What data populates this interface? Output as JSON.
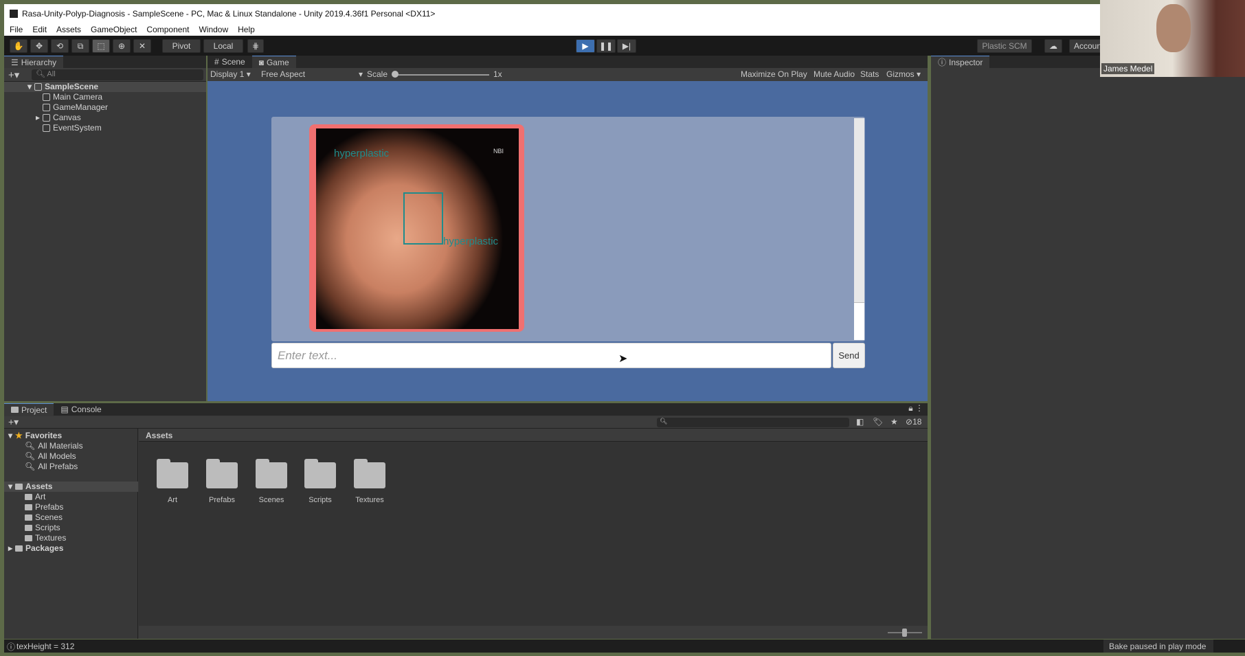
{
  "window": {
    "title": "Rasa-Unity-Polyp-Diagnosis - SampleScene - PC, Mac & Linux Standalone - Unity 2019.4.36f1 Personal <DX11>"
  },
  "menu": [
    "File",
    "Edit",
    "Assets",
    "GameObject",
    "Component",
    "Window",
    "Help"
  ],
  "toolbar": {
    "pivot": "Pivot",
    "local": "Local",
    "plastic": "Plastic SCM",
    "account": "Accoun",
    "play_state": "playing"
  },
  "hierarchy": {
    "tab": "Hierarchy",
    "search_placeholder": "All",
    "scene": "SampleScene",
    "items": [
      "Main Camera",
      "GameManager",
      "Canvas",
      "EventSystem"
    ]
  },
  "game": {
    "tabs": [
      "Scene",
      "Game"
    ],
    "active_tab": "Game",
    "display": "Display 1",
    "aspect": "Free Aspect",
    "scale_label": "Scale",
    "scale_value": "1x",
    "buttons": [
      "Maximize On Play",
      "Mute Audio",
      "Stats",
      "Gizmos"
    ]
  },
  "chat": {
    "image_labels": [
      "hyperplastic",
      "hyperplastic"
    ],
    "image_corner_text": "NBI",
    "input_placeholder": "Enter text...",
    "send": "Send",
    "accent": "#f07070",
    "label_color": "#1f8c8c"
  },
  "inspector": {
    "tab": "Inspector"
  },
  "webcam": {
    "name": "James Medel"
  },
  "project": {
    "tabs": [
      "Project",
      "Console"
    ],
    "favorites_label": "Favorites",
    "favorites": [
      "All Materials",
      "All Models",
      "All Prefabs"
    ],
    "assets_label": "Assets",
    "asset_folders": [
      "Art",
      "Prefabs",
      "Scenes",
      "Scripts",
      "Textures"
    ],
    "packages_label": "Packages",
    "breadcrumb": "Assets",
    "hidden_count": "18"
  },
  "status": {
    "left": "texHeight = 312",
    "right": "Bake paused in play mode"
  }
}
